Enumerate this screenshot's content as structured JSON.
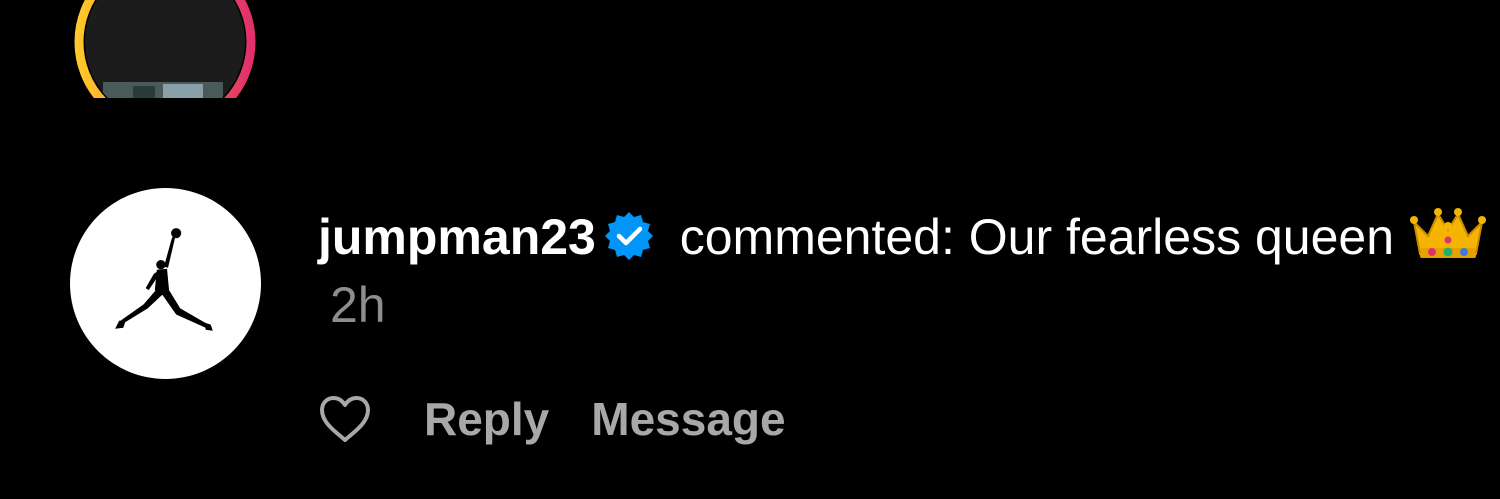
{
  "notification": {
    "previous_avatar": {
      "icon": "story-ring-avatar",
      "ring_colors": [
        "#FFC82C",
        "#F77737",
        "#E1306C"
      ]
    },
    "avatar": {
      "icon": "jumpman-logo-icon",
      "background": "#FFFFFF"
    },
    "username": "jumpman23",
    "verified_icon": "verified-badge-icon",
    "verified_color": "#0095F6",
    "action_text": " commented: Our fearless queen",
    "emoji": "crown-emoji",
    "time": "2h",
    "actions": {
      "like_icon": "heart-icon",
      "reply_label": "Reply",
      "message_label": "Message"
    },
    "colors": {
      "background": "#000000",
      "primary_text": "#FFFFFF",
      "secondary_text": "#8E8E8E",
      "action_text": "#A8A8A8"
    }
  }
}
